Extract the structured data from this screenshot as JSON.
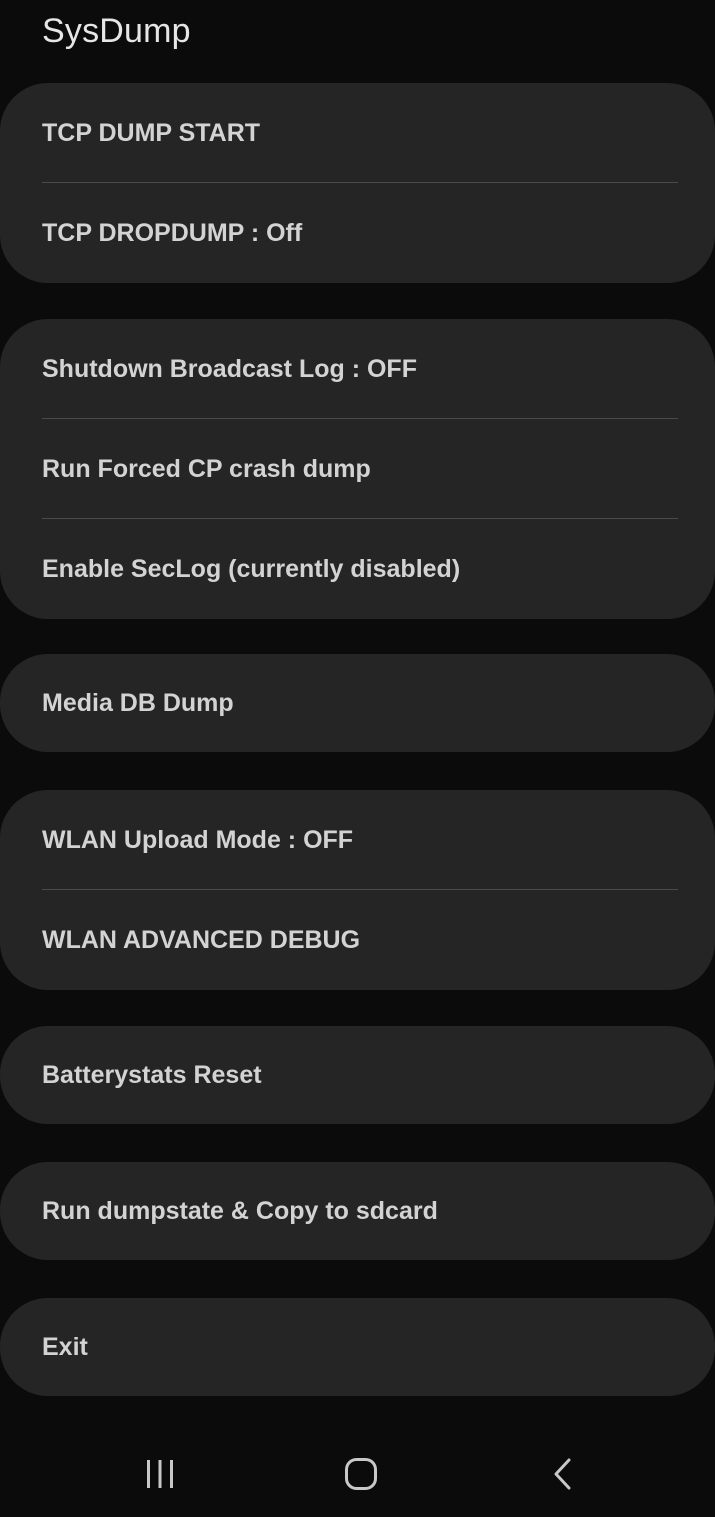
{
  "app": {
    "title": "SysDump"
  },
  "menu_groups": [
    {
      "items": [
        "TCP DUMP START",
        "TCP DROPDUMP : Off"
      ]
    },
    {
      "items": [
        "Shutdown Broadcast Log : OFF",
        "Run Forced CP crash dump",
        "Enable SecLog (currently disabled)"
      ]
    },
    {
      "items": [
        "Media DB Dump"
      ]
    },
    {
      "items": [
        "WLAN Upload Mode : OFF",
        "WLAN ADVANCED DEBUG"
      ]
    },
    {
      "items": [
        "Batterystats Reset"
      ]
    },
    {
      "items": [
        "Run dumpstate & Copy to sdcard"
      ]
    },
    {
      "items": [
        "Exit"
      ]
    }
  ],
  "navigation_bar": {
    "icons": [
      "recents-icon",
      "home-icon",
      "back-icon"
    ]
  },
  "colors": {
    "background": "#0b0b0b",
    "card": "#252525",
    "divider": "#4a4a4a",
    "text": "#d3d3d3"
  }
}
